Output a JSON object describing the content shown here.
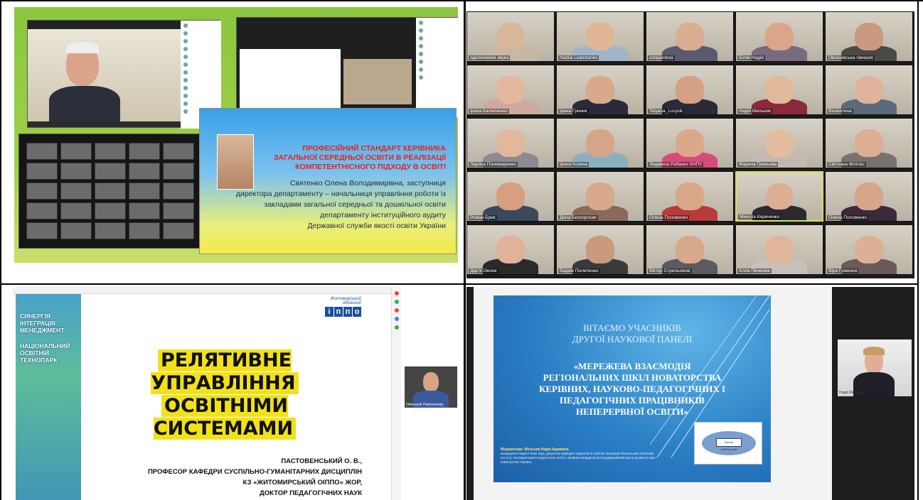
{
  "q1": {
    "slide_title": [
      "ПРОФЕСІЙНИЙ СТАНДАРТ КЕРІВНИКА",
      "ЗАГАЛЬНОЇ СЕРЕДНЬОЇ ОСВІТИ В РЕАЛІЗАЦІЇ",
      "КОМПЕТЕНТНІСНОГО ПІДХОДУ В ОСВІТІ"
    ],
    "slide_body": [
      "Святенко Олена Володимирівна, заступниця",
      "директора департаменту – начальниця управління роботи із",
      "закладами загальної середньої та дошкільної освіти",
      "департаменту інституційного аудиту",
      "Державної служби якості освіти України"
    ]
  },
  "q2": {
    "tiles": [
      {
        "name": "одключення звука",
        "body": "#c7b8a6",
        "face": "#d7b69a"
      },
      {
        "name": "Nadiia Liubchenko",
        "body": "#9fb5c9",
        "face": "#e0b596"
      },
      {
        "name": "ostapenkoa",
        "body": "#5a5a6e",
        "face": "#dcae91"
      },
      {
        "name": "Білик Надія",
        "body": "#7a6a7e",
        "face": "#dba58a"
      },
      {
        "name": "Овсюківська гімназія",
        "body": "#4a4a44",
        "face": "#c99a80"
      },
      {
        "name": "Ірина Калініченко",
        "body": "#cfa99e",
        "face": "#e2b79c"
      },
      {
        "name": "Ірина Гриник",
        "body": "#2a2a3a",
        "face": "#d9a98b"
      },
      {
        "name": "Tetyana_Lucyuk",
        "body": "#2a2a38",
        "face": "#d4a184"
      },
      {
        "name": "Надія Мельник",
        "body": "#8b2a3a",
        "face": "#e0b99b"
      },
      {
        "name": "Валентина",
        "body": "#5a6a7a",
        "face": "#dfb49a"
      },
      {
        "name": "Лариса Пономаренко",
        "body": "#8a8a90",
        "face": "#e1b89c"
      },
      {
        "name": "Ірина Козина",
        "body": "#8ab0c0",
        "face": "#d6a688"
      },
      {
        "name": "Людмила Рибазко ХНПУ",
        "body": "#d84a7a",
        "face": "#dba88a"
      },
      {
        "name": "Марина Гриньова",
        "body": "#c4b8b0",
        "face": "#e3bda0"
      },
      {
        "name": "Світлана Філіпас",
        "body": "#7a7070",
        "face": "#dcae92"
      },
      {
        "name": "Роман Брик",
        "body": "#3a4a5a",
        "face": "#d59f80"
      },
      {
        "name": "Дина Бескорская",
        "body": "#8a6a5a",
        "face": "#d8a98c"
      },
      {
        "name": "Олена Половенко",
        "body": "#b83a3a",
        "face": "#d9a788"
      },
      {
        "name": "Микола Кириченко",
        "body": "#2a2a30",
        "face": "#dcae94"
      },
      {
        "name": "Олена Половенко",
        "body": "#3a2a3a",
        "face": "#d6a68a"
      },
      {
        "name": "Дар'я Овсюк",
        "body": "#2a2a2a",
        "face": "#e0b298"
      },
      {
        "name": "Вадим Пилипенко",
        "body": "#3a3a3a",
        "face": "#c99a7e"
      },
      {
        "name": "Віктор Стрельніков",
        "body": "#5a5a60",
        "face": "#d8a88a"
      },
      {
        "name": "Алла Печенюк",
        "body": "#c8c0b8",
        "face": "#e1b59a"
      },
      {
        "name": "Віра Гуменюк",
        "body": "#6a5a5a",
        "face": "#dcb095"
      }
    ]
  },
  "q3": {
    "left_band": [
      "СИНЕРГІЯ",
      "ІНТЕГРАЦІЯ",
      "МЕНЕДЖМЕНТ",
      "",
      "НАЦІОНАЛЬНИЙ",
      "ОСВІТНІЙ",
      "ТЕХНОПАРК"
    ],
    "logo_top": "Житомирський обласний",
    "logo_letters": [
      "і",
      "п",
      "п",
      "о"
    ],
    "title_lines": [
      "РЕЛЯТИВНЕ УПРАВЛІННЯ",
      "ОСВІТНІМИ СИСТЕМАМИ"
    ],
    "author_lines": [
      "ПАСТОВЕНСЬКИЙ О. В.,",
      "ПРОФЕСОР КАФЕДРИ СУСПІЛЬНО-ГУМАНІТАРНИХ ДИСЦИПЛІН",
      "КЗ «ЖИТОМИРСЬКИЙ ОІППО» ЖОР,",
      "ДОКТОР ПЕДАГОГІЧНИХ НАУК"
    ],
    "side_cam_name": "Oleksandr Pastovensky"
  },
  "q4": {
    "greet": [
      "ВІТАЄМО УЧАСНИКІВ",
      "ДРУГОЇ НАУКОВОЇ ПАНЕЛІ"
    ],
    "panel_title": [
      "«МЕРЕЖЕВА ВЗАЄМОДІЯ",
      "РЕГІОНАЛЬНИХ ШКІЛ НОВАТОРСТВА",
      "КЕРІВНИХ, НАУКОВО-ПЕДАГОГІЧНИХ І",
      "ПЕДАГОГІЧНИХ ПРАЦІВНИКІВ",
      "НЕПЕРЕРВНОЇ ОСВІТИ»"
    ],
    "moderator_label": "Модератори: Мельник Надія Адамівна",
    "moderator_text": "кандидатка педагогічних наук, доцентка кафедри педагогіки й освітніх інновацій Рівненський обласний інститут післядипломної педагогічної освіти, керівник-координатор Координаційний центр розвитку шкіл новаторства України",
    "image_label": "Школа новаторства",
    "cam_name": "Надія Мельник"
  }
}
